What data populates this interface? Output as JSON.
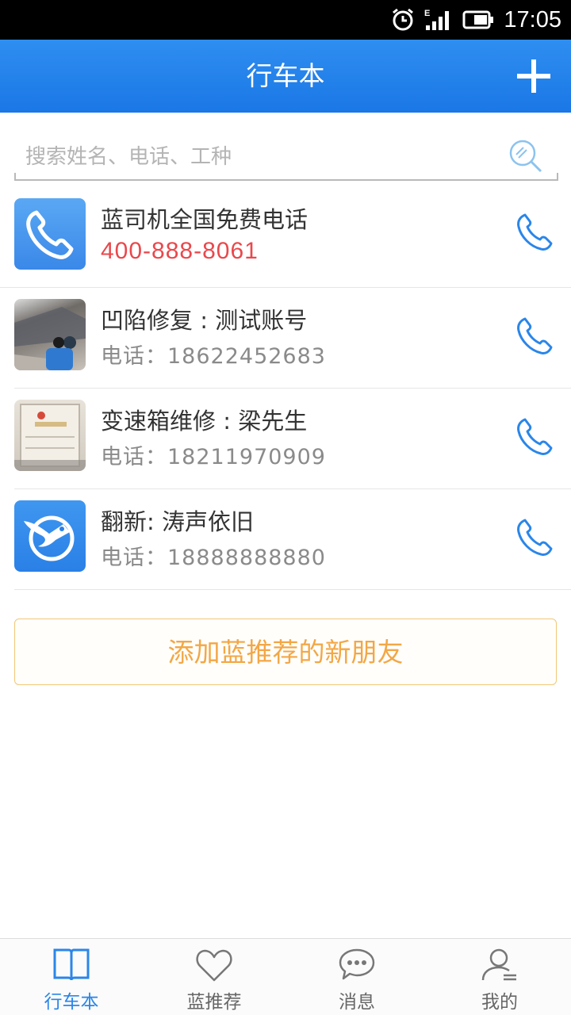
{
  "status_bar": {
    "time": "17:05",
    "network": "E"
  },
  "header": {
    "title": "行车本",
    "add_icon": "plus-icon"
  },
  "search": {
    "placeholder": "搜索姓名、电话、工种",
    "icon": "search-icon"
  },
  "hotline": {
    "name": "蓝司机全国免费电话",
    "phone": "400-888-8061",
    "icon": "phone-icon"
  },
  "contacts": [
    {
      "name": "凹陷修复 : 测试账号",
      "phone": "电话：18622452683"
    },
    {
      "name": "变速箱维修 : 梁先生",
      "phone": "电话：18211970909"
    },
    {
      "name": "翻新: 涛声依旧",
      "phone": "电话：18888888880"
    }
  ],
  "add_friends_label": "添加蓝推荐的新朋友",
  "tabs": [
    {
      "label": "行车本",
      "icon": "book-icon",
      "active": true
    },
    {
      "label": "蓝推荐",
      "icon": "heart-icon",
      "active": false
    },
    {
      "label": "消息",
      "icon": "chat-bubble-icon",
      "active": false
    },
    {
      "label": "我的",
      "icon": "user-icon",
      "active": false
    }
  ],
  "colors": {
    "accent": "#2a86e9",
    "header": "#1f80ee",
    "hotline_phone": "#e9484c",
    "add_button_text": "#f3a745"
  }
}
